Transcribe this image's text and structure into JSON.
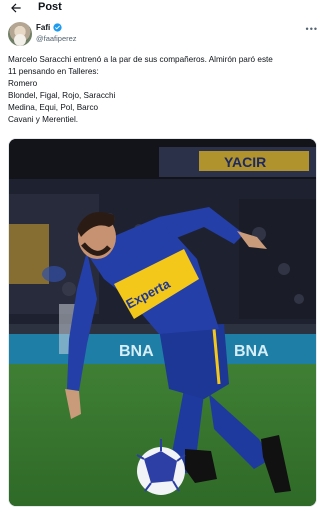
{
  "header": {
    "title": "Post",
    "back_icon": "arrow-left-icon"
  },
  "author": {
    "display_name": "Fafi",
    "handle": "@faafiperez",
    "verified_icon": "verified-badge-icon",
    "more_icon": "more-options-icon"
  },
  "tweet": {
    "lines": [
      "Marcelo Saracchi entrenó a la par de sus compañeros. Almirón paró este",
      "11 pensando en Talleres:",
      "Romero",
      "Blondel, Figal, Rojo, Saracchi",
      "Medina, Equi, Pol, Barco",
      "Cavani y Merentiel."
    ]
  },
  "media": {
    "jersey_sponsor": "Experta",
    "banner_text": "BNA",
    "stand_text": "YACIR"
  },
  "colors": {
    "text": "#0f1419",
    "secondary": "#536471",
    "verified": "#1d9bf0",
    "boca_blue": "#1f3a9e",
    "boca_yellow": "#f4c81a"
  }
}
